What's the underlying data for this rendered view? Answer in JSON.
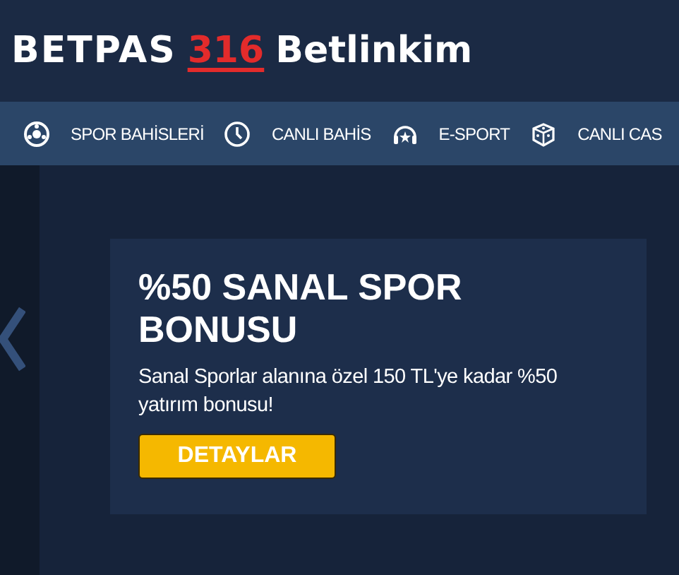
{
  "header": {
    "logo": "BETPAS",
    "logo_number": "316",
    "site_name": "Betlinkim"
  },
  "nav": [
    {
      "label": "SPOR BAHİSLERİ"
    },
    {
      "label": "CANLI BAHİS"
    },
    {
      "label": "E-SPORT"
    },
    {
      "label": "CANLI CAS"
    }
  ],
  "promo": {
    "title": "%50 SANAL SPOR BONUSU",
    "description": "Sanal Sporlar alanına özel 150 TL'ye kadar %50 yatırım bonusu!",
    "button": "DETAYLAR"
  }
}
